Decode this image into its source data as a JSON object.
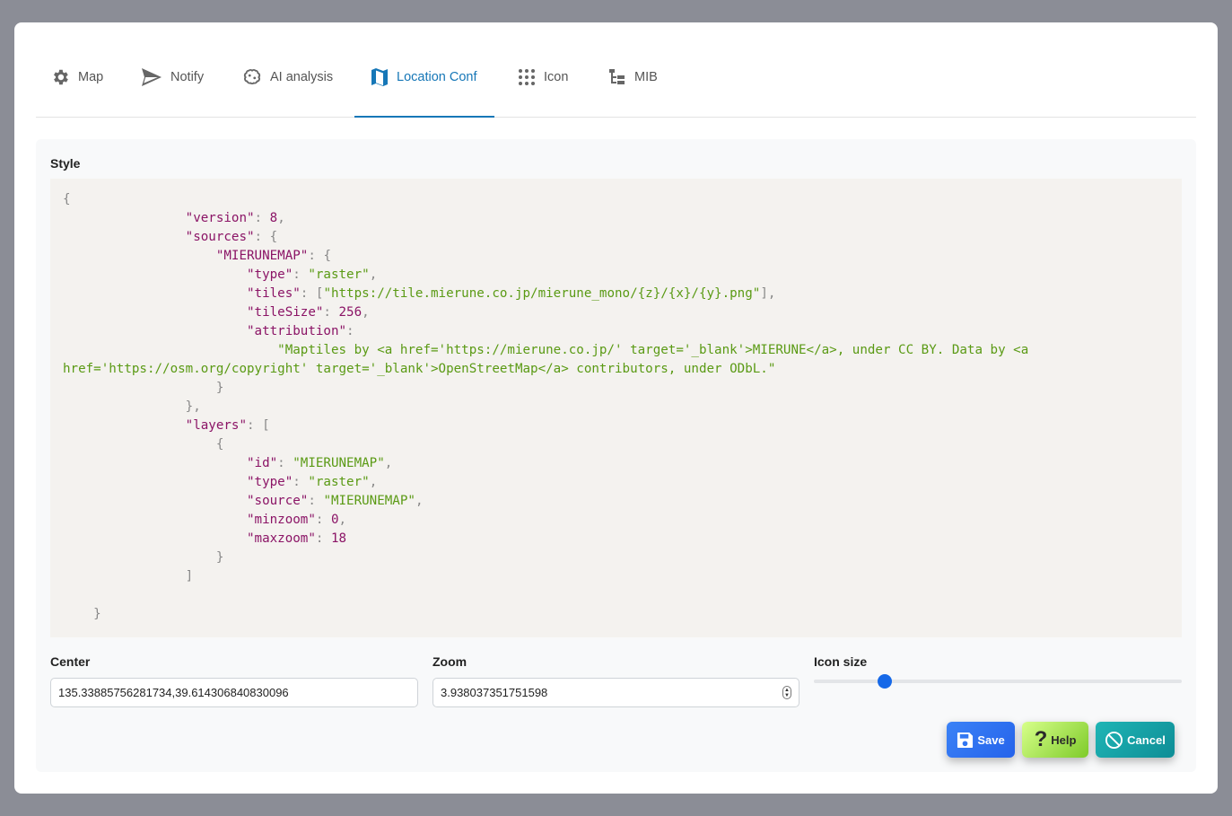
{
  "tabs": [
    {
      "label": "Map",
      "icon": "gear-icon"
    },
    {
      "label": "Notify",
      "icon": "send-icon"
    },
    {
      "label": "AI analysis",
      "icon": "brain-icon"
    },
    {
      "label": "Location Conf",
      "icon": "map-icon",
      "active": true
    },
    {
      "label": "Icon",
      "icon": "grid-icon"
    },
    {
      "label": "MIB",
      "icon": "tree-icon"
    }
  ],
  "style": {
    "label": "Style",
    "code_lines": [
      "{",
      "                \"version\": 8,",
      "                \"sources\": {",
      "                    \"MIERUNEMAP\": {",
      "                        \"type\": \"raster\",",
      "                        \"tiles\": [\"https://tile.mierune.co.jp/mierune_mono/{z}/{x}/{y}.png\"],",
      "                        \"tileSize\": 256,",
      "                        \"attribution\":",
      "                            \"Maptiles by <a href='https://mierune.co.jp/' target='_blank'>MIERUNE</a>, under CC BY. Data by <a",
      "href='https://osm.org/copyright' target='_blank'>OpenStreetMap</a> contributors, under ODbL.\"",
      "                    }",
      "                },",
      "                \"layers\": [",
      "                    {",
      "                        \"id\": \"MIERUNEMAP\",",
      "                        \"type\": \"raster\",",
      "                        \"source\": \"MIERUNEMAP\",",
      "                        \"minzoom\": 0,",
      "                        \"maxzoom\": 18",
      "                    }",
      "                ]",
      "",
      "    }"
    ]
  },
  "center": {
    "label": "Center",
    "value": "135.33885756281734,39.614306840830096"
  },
  "zoom": {
    "label": "Zoom",
    "value": "3.938037351751598"
  },
  "icon_size": {
    "label": "Icon size",
    "value_fraction": 0.18
  },
  "buttons": {
    "save": "Save",
    "help": "Help",
    "cancel": "Cancel"
  },
  "colors": {
    "accent": "#1677b7",
    "save": "#2563eb",
    "help": "#7ecb2a",
    "cancel": "#0e8d96"
  }
}
